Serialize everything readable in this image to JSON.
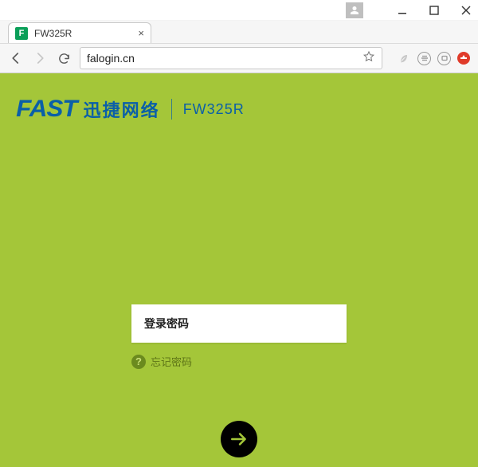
{
  "window": {
    "tab_title": "FW325R",
    "favicon_letter": "F"
  },
  "toolbar": {
    "url": "falogin.cn"
  },
  "page": {
    "brand_logo": "FAST",
    "brand_chinese": "迅捷网络",
    "model": "FW325R",
    "password_label": "登录密码",
    "forgot_label": "忘记密码"
  }
}
